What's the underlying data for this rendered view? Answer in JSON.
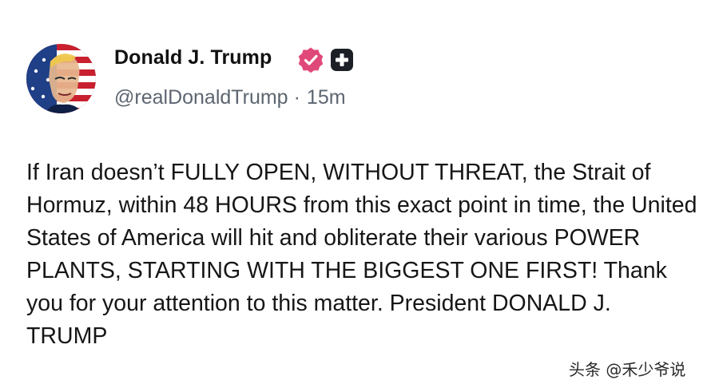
{
  "colors": {
    "verified_badge": "#e0487a",
    "plus_badge": "#1c1f26",
    "text": "#161616",
    "handle_text": "#5c6570"
  },
  "post": {
    "author": {
      "display_name": "Donald J. Trump",
      "handle": "@realDonaldTrump",
      "separator": "·",
      "time_ago": "15m",
      "verified_icon": "verified-check-icon",
      "plus_icon": "plus-badge-icon"
    },
    "text": "If Iran doesn’t FULLY OPEN, WITHOUT THREAT, the Strait of Hormuz, within 48 HOURS from this exact point in time, the United States of America will hit and obliterate their various POWER PLANTS, STARTING WITH THE BIGGEST ONE FIRST! Thank you for your attention to this matter. President DONALD J. TRUMP"
  },
  "watermark": {
    "text": "头条 @禾少爷说"
  }
}
